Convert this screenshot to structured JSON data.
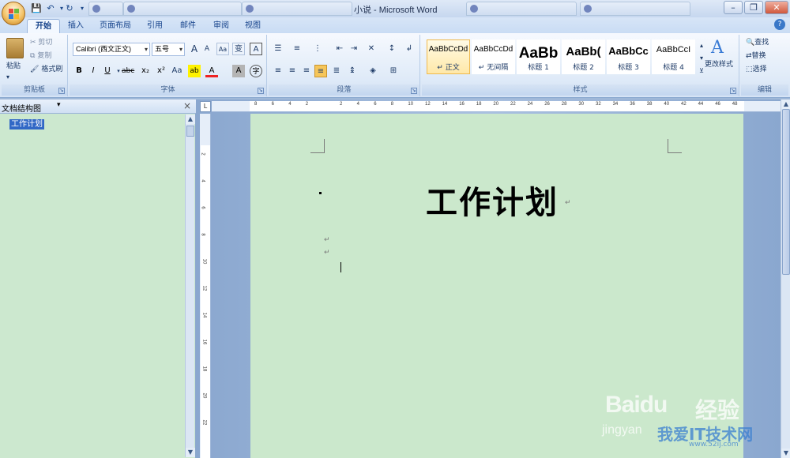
{
  "titlebar": {
    "window_title": "小说 - Microsoft Word",
    "min": "–",
    "max": "❐",
    "close": "✕"
  },
  "menu": {
    "tabs": [
      "开始",
      "插入",
      "页面布局",
      "引用",
      "邮件",
      "审阅",
      "视图"
    ],
    "help": "?"
  },
  "ribbon": {
    "clipboard": {
      "paste": "粘贴",
      "cut": "剪切",
      "copy": "复制",
      "format_painter": "格式刷",
      "label": "剪贴板"
    },
    "font": {
      "name": "Calibri (西文正文)",
      "size": "五号",
      "label": "字体",
      "bold": "B",
      "italic": "I",
      "underline": "U",
      "strike": "abc",
      "sub": "x₂",
      "sup": "x²",
      "grow": "A",
      "shrink": "A",
      "clear": "Aa",
      "phonetic": "变",
      "border": "A",
      "highlight": "ab",
      "color": "A",
      "shade": "A",
      "encircle": "字"
    },
    "paragraph": {
      "label": "段落"
    },
    "styles": {
      "label": "样式",
      "items": [
        {
          "sample": "AaBbCcDd",
          "name": "↵ 正文",
          "selected": true,
          "size": 10
        },
        {
          "sample": "AaBbCcDd",
          "name": "↵ 无间隔",
          "selected": false,
          "size": 10
        },
        {
          "sample": "AaBb",
          "name": "标题 1",
          "selected": false,
          "size": 19
        },
        {
          "sample": "AaBb(",
          "name": "标题 2",
          "selected": false,
          "size": 15
        },
        {
          "sample": "AaBbCc",
          "name": "标题 3",
          "selected": false,
          "size": 13
        },
        {
          "sample": "AaBbCcI",
          "name": "标题 4",
          "selected": false,
          "size": 11
        }
      ],
      "change": "更改样式"
    },
    "editing": {
      "find": "查找",
      "replace": "替换",
      "select": "选择",
      "label": "编辑"
    }
  },
  "navpane": {
    "title": "文档结构图",
    "item": "工作计划"
  },
  "ruler": {
    "h_ticks": [
      "8",
      "6",
      "4",
      "2",
      "",
      "2",
      "4",
      "6",
      "8",
      "10",
      "12",
      "14",
      "16",
      "18",
      "20",
      "22",
      "24",
      "26",
      "28",
      "30",
      "32",
      "34",
      "36",
      "38",
      "40",
      "42",
      "44",
      "46",
      "48"
    ],
    "v_ticks": [
      "2",
      "4",
      "6",
      "8",
      "10",
      "12",
      "14",
      "16",
      "18",
      "20",
      "22"
    ]
  },
  "document": {
    "title": "工作计划",
    "para_mark": "↵"
  },
  "watermark": {
    "brand": "Baidu",
    "jingyan": "经验",
    "url": "jingyan",
    "site": "我爱IT技术网",
    "small": "www.52ij.com"
  }
}
